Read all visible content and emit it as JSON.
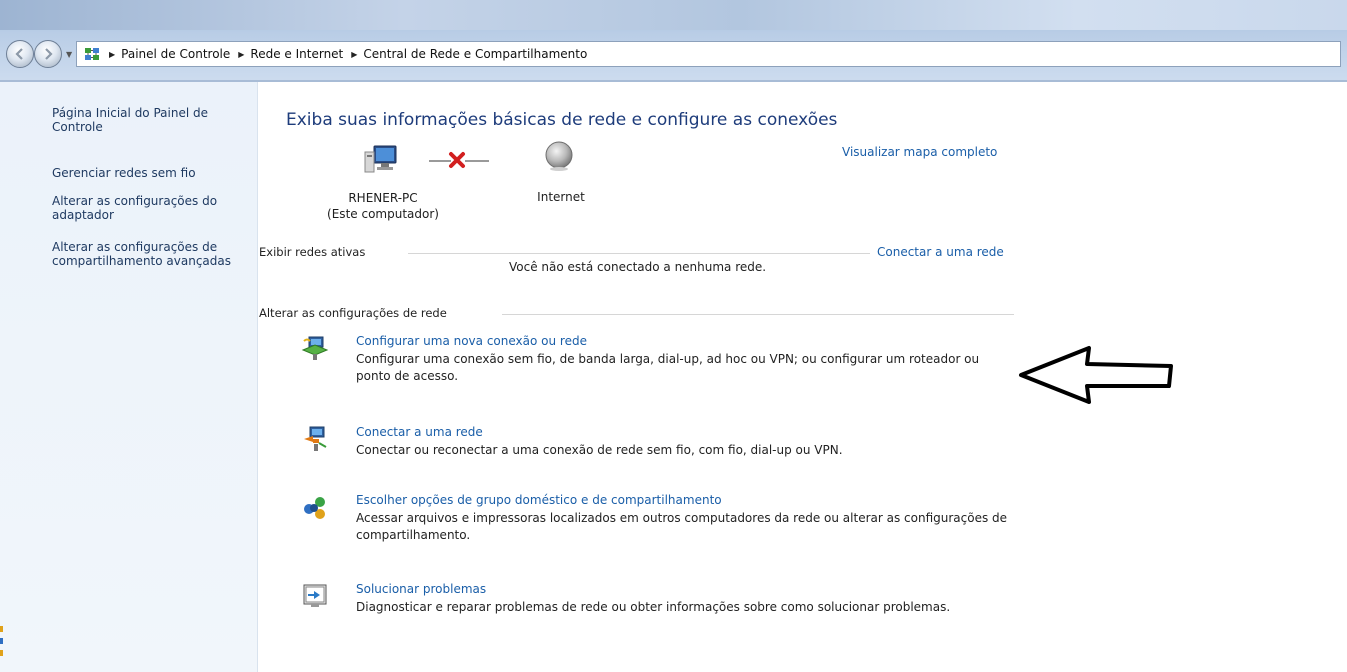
{
  "breadcrumb": {
    "items": [
      "Painel de Controle",
      "Rede e Internet",
      "Central de Rede e Compartilhamento"
    ]
  },
  "sidebar": {
    "links": [
      "Página Inicial do Painel de Controle",
      "Gerenciar redes sem fio",
      "Alterar as configurações do adaptador",
      "Alterar as configurações de compartilhamento avançadas"
    ]
  },
  "main": {
    "heading": "Exiba suas informações básicas de rede e configure as conexões",
    "view_full_map": "Visualizar mapa completo",
    "map": {
      "computer_name": "RHENER-PC",
      "computer_sub": "(Este computador)",
      "internet_label": "Internet",
      "connection_status": "disconnected"
    },
    "active_networks": {
      "title": "Exibir redes ativas",
      "connect_link": "Conectar a uma rede",
      "empty_message": "Você não está conectado a nenhuma rede."
    },
    "change_settings": {
      "title": "Alterar as configurações de rede",
      "tasks": [
        {
          "icon": "new-connection-icon",
          "link": "Configurar uma nova conexão ou rede",
          "description": "Configurar uma conexão sem fio, de banda larga, dial-up, ad hoc ou VPN; ou configurar um roteador ou ponto de acesso."
        },
        {
          "icon": "connect-network-icon",
          "link": "Conectar a uma rede",
          "description": "Conectar ou reconectar a uma conexão de rede sem fio, com fio, dial-up ou VPN."
        },
        {
          "icon": "homegroup-icon",
          "link": "Escolher opções de grupo doméstico e de compartilhamento",
          "description": "Acessar arquivos e impressoras localizados em outros computadores da rede ou alterar as configurações de compartilhamento."
        },
        {
          "icon": "troubleshoot-icon",
          "link": "Solucionar problemas",
          "description": "Diagnosticar e reparar problemas de rede ou obter informações sobre como solucionar problemas."
        }
      ]
    }
  },
  "colors": {
    "link": "#1a5ea8",
    "heading": "#1e3c7b",
    "sidebar_bg": "#ebf2fa",
    "error_x": "#d21f1f"
  }
}
